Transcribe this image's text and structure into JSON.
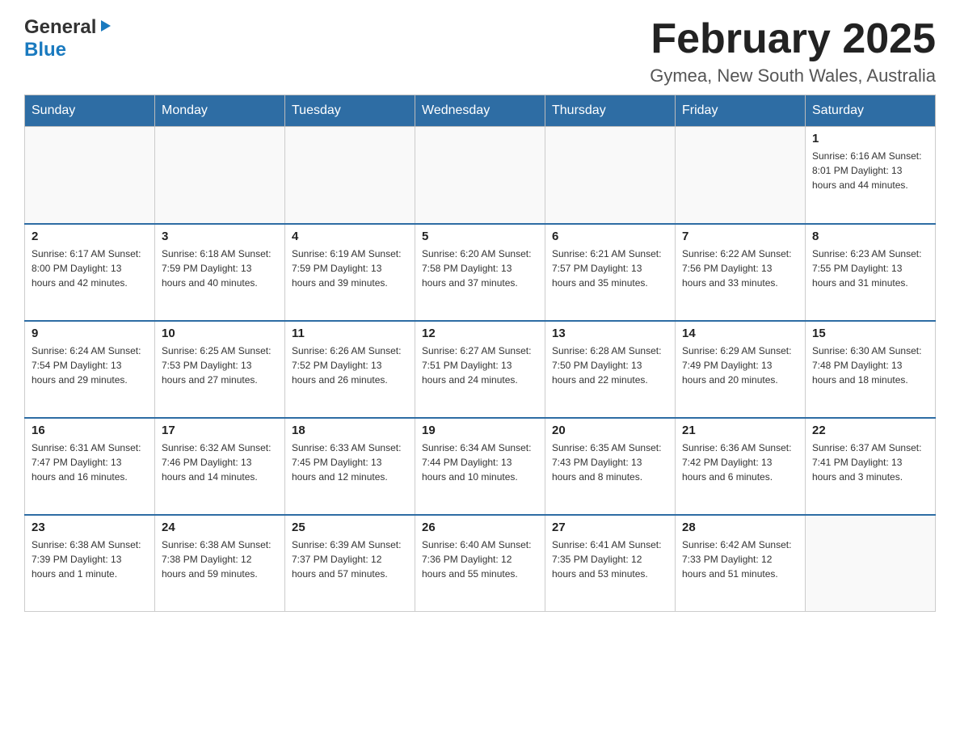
{
  "header": {
    "logo": {
      "general": "General",
      "blue": "Blue",
      "arrow": "▶"
    },
    "title": "February 2025",
    "location": "Gymea, New South Wales, Australia"
  },
  "calendar": {
    "days_of_week": [
      "Sunday",
      "Monday",
      "Tuesday",
      "Wednesday",
      "Thursday",
      "Friday",
      "Saturday"
    ],
    "weeks": [
      [
        {
          "day": "",
          "info": ""
        },
        {
          "day": "",
          "info": ""
        },
        {
          "day": "",
          "info": ""
        },
        {
          "day": "",
          "info": ""
        },
        {
          "day": "",
          "info": ""
        },
        {
          "day": "",
          "info": ""
        },
        {
          "day": "1",
          "info": "Sunrise: 6:16 AM\nSunset: 8:01 PM\nDaylight: 13 hours and 44 minutes."
        }
      ],
      [
        {
          "day": "2",
          "info": "Sunrise: 6:17 AM\nSunset: 8:00 PM\nDaylight: 13 hours and 42 minutes."
        },
        {
          "day": "3",
          "info": "Sunrise: 6:18 AM\nSunset: 7:59 PM\nDaylight: 13 hours and 40 minutes."
        },
        {
          "day": "4",
          "info": "Sunrise: 6:19 AM\nSunset: 7:59 PM\nDaylight: 13 hours and 39 minutes."
        },
        {
          "day": "5",
          "info": "Sunrise: 6:20 AM\nSunset: 7:58 PM\nDaylight: 13 hours and 37 minutes."
        },
        {
          "day": "6",
          "info": "Sunrise: 6:21 AM\nSunset: 7:57 PM\nDaylight: 13 hours and 35 minutes."
        },
        {
          "day": "7",
          "info": "Sunrise: 6:22 AM\nSunset: 7:56 PM\nDaylight: 13 hours and 33 minutes."
        },
        {
          "day": "8",
          "info": "Sunrise: 6:23 AM\nSunset: 7:55 PM\nDaylight: 13 hours and 31 minutes."
        }
      ],
      [
        {
          "day": "9",
          "info": "Sunrise: 6:24 AM\nSunset: 7:54 PM\nDaylight: 13 hours and 29 minutes."
        },
        {
          "day": "10",
          "info": "Sunrise: 6:25 AM\nSunset: 7:53 PM\nDaylight: 13 hours and 27 minutes."
        },
        {
          "day": "11",
          "info": "Sunrise: 6:26 AM\nSunset: 7:52 PM\nDaylight: 13 hours and 26 minutes."
        },
        {
          "day": "12",
          "info": "Sunrise: 6:27 AM\nSunset: 7:51 PM\nDaylight: 13 hours and 24 minutes."
        },
        {
          "day": "13",
          "info": "Sunrise: 6:28 AM\nSunset: 7:50 PM\nDaylight: 13 hours and 22 minutes."
        },
        {
          "day": "14",
          "info": "Sunrise: 6:29 AM\nSunset: 7:49 PM\nDaylight: 13 hours and 20 minutes."
        },
        {
          "day": "15",
          "info": "Sunrise: 6:30 AM\nSunset: 7:48 PM\nDaylight: 13 hours and 18 minutes."
        }
      ],
      [
        {
          "day": "16",
          "info": "Sunrise: 6:31 AM\nSunset: 7:47 PM\nDaylight: 13 hours and 16 minutes."
        },
        {
          "day": "17",
          "info": "Sunrise: 6:32 AM\nSunset: 7:46 PM\nDaylight: 13 hours and 14 minutes."
        },
        {
          "day": "18",
          "info": "Sunrise: 6:33 AM\nSunset: 7:45 PM\nDaylight: 13 hours and 12 minutes."
        },
        {
          "day": "19",
          "info": "Sunrise: 6:34 AM\nSunset: 7:44 PM\nDaylight: 13 hours and 10 minutes."
        },
        {
          "day": "20",
          "info": "Sunrise: 6:35 AM\nSunset: 7:43 PM\nDaylight: 13 hours and 8 minutes."
        },
        {
          "day": "21",
          "info": "Sunrise: 6:36 AM\nSunset: 7:42 PM\nDaylight: 13 hours and 6 minutes."
        },
        {
          "day": "22",
          "info": "Sunrise: 6:37 AM\nSunset: 7:41 PM\nDaylight: 13 hours and 3 minutes."
        }
      ],
      [
        {
          "day": "23",
          "info": "Sunrise: 6:38 AM\nSunset: 7:39 PM\nDaylight: 13 hours and 1 minute."
        },
        {
          "day": "24",
          "info": "Sunrise: 6:38 AM\nSunset: 7:38 PM\nDaylight: 12 hours and 59 minutes."
        },
        {
          "day": "25",
          "info": "Sunrise: 6:39 AM\nSunset: 7:37 PM\nDaylight: 12 hours and 57 minutes."
        },
        {
          "day": "26",
          "info": "Sunrise: 6:40 AM\nSunset: 7:36 PM\nDaylight: 12 hours and 55 minutes."
        },
        {
          "day": "27",
          "info": "Sunrise: 6:41 AM\nSunset: 7:35 PM\nDaylight: 12 hours and 53 minutes."
        },
        {
          "day": "28",
          "info": "Sunrise: 6:42 AM\nSunset: 7:33 PM\nDaylight: 12 hours and 51 minutes."
        },
        {
          "day": "",
          "info": ""
        }
      ]
    ]
  }
}
